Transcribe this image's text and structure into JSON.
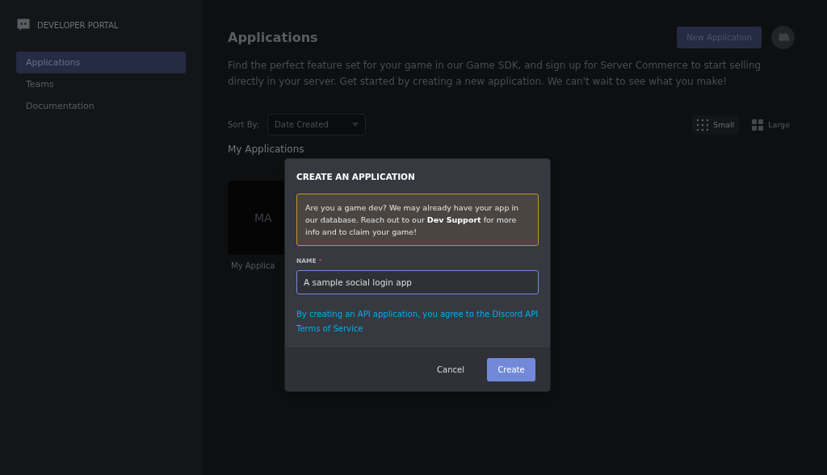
{
  "sidebar": {
    "brand": "DEVELOPER PORTAL",
    "items": [
      {
        "label": "Applications",
        "selected": true
      },
      {
        "label": "Teams",
        "selected": false
      },
      {
        "label": "Documentation",
        "selected": false
      }
    ]
  },
  "header": {
    "title": "Applications",
    "new_button": "New Application"
  },
  "intro": "Find the perfect feature set for your game in our Game SDK, and sign up for Server Commerce to start selling directly in your server. Get started by creating a new application. We can't wait to see what you make!",
  "sort": {
    "label": "Sort By:",
    "value": "Date Created"
  },
  "view_options": [
    {
      "label": "Small",
      "kind": "small",
      "selected": true
    },
    {
      "label": "Large",
      "kind": "large",
      "selected": false
    }
  ],
  "section_title": "My Applications",
  "apps": [
    {
      "initials": "MA",
      "name": "My Applica"
    }
  ],
  "dialog": {
    "title": "CREATE AN APPLICATION",
    "notice": "Are you a game dev? We may already have your app in our database. Reach out to our **Dev Support** for more info and to claim your game!",
    "field_label": "NAME",
    "required": true,
    "required_mark": "*",
    "field_value": "A sample social login app",
    "terms": "By creating an API application, you agree to the Discord API Terms of Service",
    "cancel": "Cancel",
    "create": "Create"
  }
}
